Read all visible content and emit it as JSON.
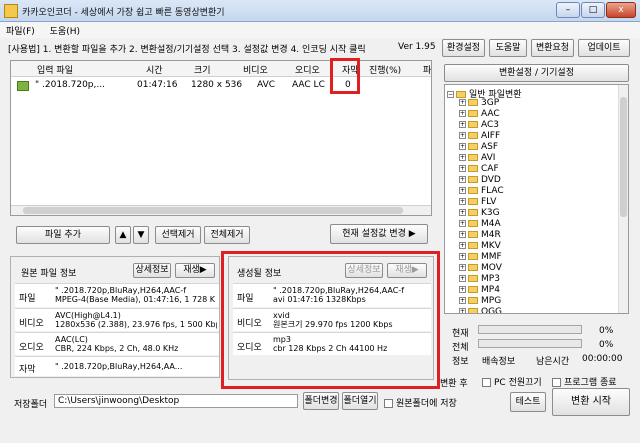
{
  "window": {
    "title": "카카오인코더 - 세상에서 가장 쉽고 빠른 동영상변환기",
    "min": "–",
    "max": "□",
    "close": "x"
  },
  "menu": [
    "파일(F)",
    "도움(H)"
  ],
  "steps": "[사용법] 1. 변환할 파일을 추가  2. 변환설정/기기설정 선택  3. 설정값 변경  4. 인코딩 시작 클릭",
  "version": "Ver 1.95",
  "top_buttons": [
    "환경설정",
    "도움말",
    "변환요청",
    "업데이트"
  ],
  "file_list": {
    "columns": [
      "입력 파일",
      "시간",
      "크기",
      "비디오",
      "오디오",
      "자막",
      "진행(%)",
      "파"
    ],
    "rows": [
      {
        "file": "\"         .2018.720p,...",
        "time": "01:47:16",
        "size": "1280 x 536",
        "video": "AVC",
        "audio": "AAC LC",
        "subtitle": "0",
        "progress": ""
      }
    ]
  },
  "list_buttons": {
    "add": "파일 추가",
    "up": "▲",
    "down": "▼",
    "remove_sel": "선택제거",
    "remove_all": "전체제거",
    "apply": "현재 설정값 변경 ▶"
  },
  "source_info": {
    "title": "원본 파일 정보",
    "detail_btn": "상세정보",
    "play_btn": "재생▶",
    "rows": [
      {
        "label": "파일",
        "lines": [
          "  \"          .2018.720p,BluRay,H264,AAC-f",
          "MPEG-4(Base Media), 01:47:16, 1 728 K"
        ]
      },
      {
        "label": "비디오",
        "lines": [
          "AVC(High@L4.1)",
          "1280x536 (2.388), 23.976 fps, 1 500 Kbps"
        ]
      },
      {
        "label": "오디오",
        "lines": [
          "AAC(LC)",
          "CBR, 224 Kbps, 2 Ch, 48.0 KHz"
        ]
      },
      {
        "label": "자막",
        "lines": [
          "\"        .2018.720p,BluRay,H264,AA..."
        ]
      }
    ]
  },
  "output_info": {
    "title": "생성될 정보",
    "detail_btn": "상세정보",
    "play_btn": "재생▶",
    "rows": [
      {
        "label": "파일",
        "lines": [
          "\"         .2018.720p,BluRay,H264,AAC-f",
          "avi   01:47:16   1328Kbps"
        ]
      },
      {
        "label": "비디오",
        "lines": [
          "xvid",
          "원본크기   29.970 fps   1200 Kbps"
        ]
      },
      {
        "label": "오디오",
        "lines": [
          "mp3",
          "cbr     128 Kbps   2 Ch   44100 Hz"
        ]
      }
    ]
  },
  "settings": {
    "header": "변환설정 / 기기설정",
    "root": "일반 파일변환",
    "items": [
      "3GP",
      "AAC",
      "AC3",
      "AIFF",
      "ASF",
      "AVI",
      "CAF",
      "DVD",
      "FLAC",
      "FLV",
      "K3G",
      "M4A",
      "M4R",
      "MKV",
      "MMF",
      "MOV",
      "MP3",
      "MP4",
      "MPG",
      "OGG"
    ]
  },
  "status": {
    "current_label": "현재",
    "current_value": 0,
    "current_pct": "0%",
    "total_label": "전체",
    "total_value": 0,
    "total_pct": "0%",
    "info_label": "정보",
    "speed_label": "배속정보",
    "remain_label": "남은시간",
    "remain_value": "00:00:00"
  },
  "after_convert": {
    "label": "변환 후",
    "pc_off": "PC 전원끄기",
    "exit": "프로그램 종료"
  },
  "save": {
    "label": "저장폴더",
    "path": "C:\\Users\\jinwoong\\Desktop",
    "change_btn": "폴더변경",
    "open_btn": "폴더열기",
    "same_folder": "원본폴더에 저장"
  },
  "bottom_buttons": {
    "test": "테스트",
    "start": "변환 시작"
  },
  "colors": {
    "highlight": "#e02020",
    "progress_fill": "#3bb33b"
  }
}
